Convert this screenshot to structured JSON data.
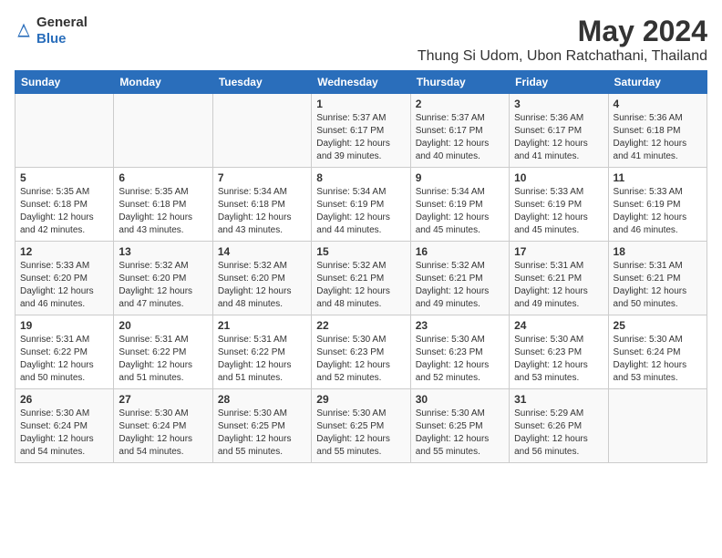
{
  "logo": {
    "general": "General",
    "blue": "Blue"
  },
  "title": "May 2024",
  "subtitle": "Thung Si Udom, Ubon Ratchathani, Thailand",
  "headers": [
    "Sunday",
    "Monday",
    "Tuesday",
    "Wednesday",
    "Thursday",
    "Friday",
    "Saturday"
  ],
  "weeks": [
    [
      {
        "day": "",
        "info": ""
      },
      {
        "day": "",
        "info": ""
      },
      {
        "day": "",
        "info": ""
      },
      {
        "day": "1",
        "info": "Sunrise: 5:37 AM\nSunset: 6:17 PM\nDaylight: 12 hours\nand 39 minutes."
      },
      {
        "day": "2",
        "info": "Sunrise: 5:37 AM\nSunset: 6:17 PM\nDaylight: 12 hours\nand 40 minutes."
      },
      {
        "day": "3",
        "info": "Sunrise: 5:36 AM\nSunset: 6:17 PM\nDaylight: 12 hours\nand 41 minutes."
      },
      {
        "day": "4",
        "info": "Sunrise: 5:36 AM\nSunset: 6:18 PM\nDaylight: 12 hours\nand 41 minutes."
      }
    ],
    [
      {
        "day": "5",
        "info": "Sunrise: 5:35 AM\nSunset: 6:18 PM\nDaylight: 12 hours\nand 42 minutes."
      },
      {
        "day": "6",
        "info": "Sunrise: 5:35 AM\nSunset: 6:18 PM\nDaylight: 12 hours\nand 43 minutes."
      },
      {
        "day": "7",
        "info": "Sunrise: 5:34 AM\nSunset: 6:18 PM\nDaylight: 12 hours\nand 43 minutes."
      },
      {
        "day": "8",
        "info": "Sunrise: 5:34 AM\nSunset: 6:19 PM\nDaylight: 12 hours\nand 44 minutes."
      },
      {
        "day": "9",
        "info": "Sunrise: 5:34 AM\nSunset: 6:19 PM\nDaylight: 12 hours\nand 45 minutes."
      },
      {
        "day": "10",
        "info": "Sunrise: 5:33 AM\nSunset: 6:19 PM\nDaylight: 12 hours\nand 45 minutes."
      },
      {
        "day": "11",
        "info": "Sunrise: 5:33 AM\nSunset: 6:19 PM\nDaylight: 12 hours\nand 46 minutes."
      }
    ],
    [
      {
        "day": "12",
        "info": "Sunrise: 5:33 AM\nSunset: 6:20 PM\nDaylight: 12 hours\nand 46 minutes."
      },
      {
        "day": "13",
        "info": "Sunrise: 5:32 AM\nSunset: 6:20 PM\nDaylight: 12 hours\nand 47 minutes."
      },
      {
        "day": "14",
        "info": "Sunrise: 5:32 AM\nSunset: 6:20 PM\nDaylight: 12 hours\nand 48 minutes."
      },
      {
        "day": "15",
        "info": "Sunrise: 5:32 AM\nSunset: 6:21 PM\nDaylight: 12 hours\nand 48 minutes."
      },
      {
        "day": "16",
        "info": "Sunrise: 5:32 AM\nSunset: 6:21 PM\nDaylight: 12 hours\nand 49 minutes."
      },
      {
        "day": "17",
        "info": "Sunrise: 5:31 AM\nSunset: 6:21 PM\nDaylight: 12 hours\nand 49 minutes."
      },
      {
        "day": "18",
        "info": "Sunrise: 5:31 AM\nSunset: 6:21 PM\nDaylight: 12 hours\nand 50 minutes."
      }
    ],
    [
      {
        "day": "19",
        "info": "Sunrise: 5:31 AM\nSunset: 6:22 PM\nDaylight: 12 hours\nand 50 minutes."
      },
      {
        "day": "20",
        "info": "Sunrise: 5:31 AM\nSunset: 6:22 PM\nDaylight: 12 hours\nand 51 minutes."
      },
      {
        "day": "21",
        "info": "Sunrise: 5:31 AM\nSunset: 6:22 PM\nDaylight: 12 hours\nand 51 minutes."
      },
      {
        "day": "22",
        "info": "Sunrise: 5:30 AM\nSunset: 6:23 PM\nDaylight: 12 hours\nand 52 minutes."
      },
      {
        "day": "23",
        "info": "Sunrise: 5:30 AM\nSunset: 6:23 PM\nDaylight: 12 hours\nand 52 minutes."
      },
      {
        "day": "24",
        "info": "Sunrise: 5:30 AM\nSunset: 6:23 PM\nDaylight: 12 hours\nand 53 minutes."
      },
      {
        "day": "25",
        "info": "Sunrise: 5:30 AM\nSunset: 6:24 PM\nDaylight: 12 hours\nand 53 minutes."
      }
    ],
    [
      {
        "day": "26",
        "info": "Sunrise: 5:30 AM\nSunset: 6:24 PM\nDaylight: 12 hours\nand 54 minutes."
      },
      {
        "day": "27",
        "info": "Sunrise: 5:30 AM\nSunset: 6:24 PM\nDaylight: 12 hours\nand 54 minutes."
      },
      {
        "day": "28",
        "info": "Sunrise: 5:30 AM\nSunset: 6:25 PM\nDaylight: 12 hours\nand 55 minutes."
      },
      {
        "day": "29",
        "info": "Sunrise: 5:30 AM\nSunset: 6:25 PM\nDaylight: 12 hours\nand 55 minutes."
      },
      {
        "day": "30",
        "info": "Sunrise: 5:30 AM\nSunset: 6:25 PM\nDaylight: 12 hours\nand 55 minutes."
      },
      {
        "day": "31",
        "info": "Sunrise: 5:29 AM\nSunset: 6:26 PM\nDaylight: 12 hours\nand 56 minutes."
      },
      {
        "day": "",
        "info": ""
      }
    ]
  ]
}
